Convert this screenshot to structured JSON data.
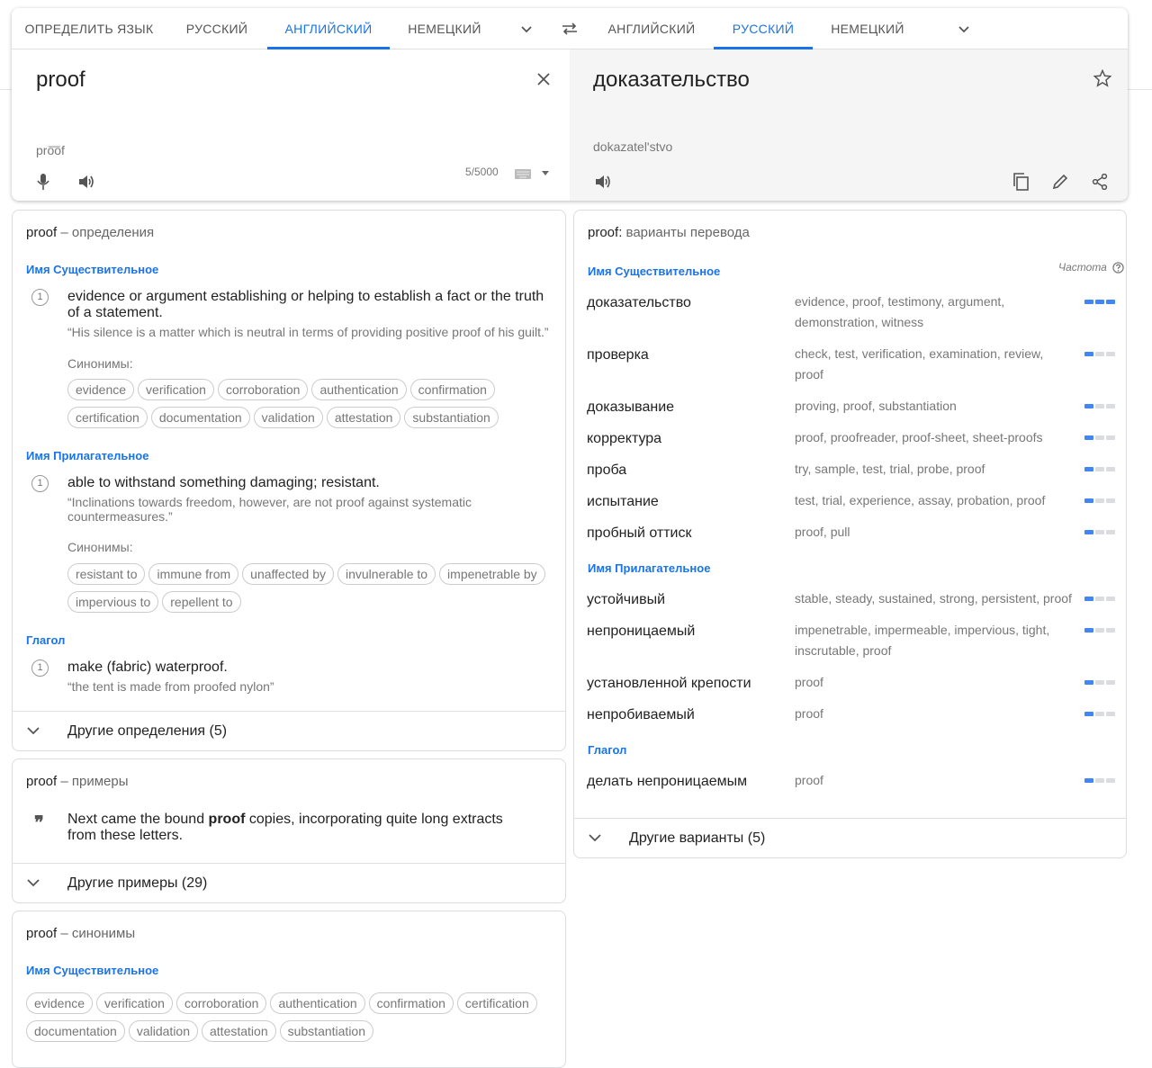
{
  "source_langs": [
    "ОПРЕДЕЛИТЬ ЯЗЫК",
    "РУССКИЙ",
    "АНГЛИЙСКИЙ",
    "НЕМЕЦКИЙ"
  ],
  "target_langs": [
    "АНГЛИЙСКИЙ",
    "РУССКИЙ",
    "НЕМЕЦКИЙ"
  ],
  "source_active": "АНГЛИЙСКИЙ",
  "target_active": "РУССКИЙ",
  "source": {
    "text": "proof",
    "translit": "pro͞of",
    "counter": "5/5000"
  },
  "target": {
    "text": "доказательство",
    "translit": "dokazatel'stvo"
  },
  "definitions": {
    "word": "proof",
    "title_suffix": "– определения",
    "noun": {
      "pos": "Имя Существительное",
      "num": "1",
      "def": "evidence or argument establishing or helping to establish a fact or the truth of a statement.",
      "example": "“His silence is a matter which is neutral in terms of providing positive proof of his guilt.”",
      "syn_label": "Синонимы:",
      "synonyms": [
        "evidence",
        "verification",
        "corroboration",
        "authentication",
        "confirmation",
        "certification",
        "documentation",
        "validation",
        "attestation",
        "substantiation"
      ]
    },
    "adj": {
      "pos": "Имя Прилагательное",
      "num": "1",
      "def": "able to withstand something damaging; resistant.",
      "example": "“Inclinations towards freedom, however, are not proof against systematic countermeasures.”",
      "syn_label": "Синонимы:",
      "synonyms": [
        "resistant to",
        "immune from",
        "unaffected by",
        "invulnerable to",
        "impenetrable by",
        "impervious to",
        "repellent to"
      ]
    },
    "verb": {
      "pos": "Глагол",
      "num": "1",
      "def": "make (fabric) waterproof.",
      "example": "“the tent is made from proofed nylon”"
    },
    "more": "Другие определения (5)"
  },
  "examples": {
    "word": "proof",
    "title_suffix": "– примеры",
    "quote_icon": "❞",
    "before": "Next came the bound ",
    "bold": "proof",
    "after": " copies, incorporating quite long extracts from these letters.",
    "more": "Другие примеры (29)"
  },
  "synonyms_card": {
    "word": "proof",
    "title_suffix": "– синонимы",
    "pos": "Имя Существительное",
    "items": [
      "evidence",
      "verification",
      "corroboration",
      "authentication",
      "confirmation",
      "certification",
      "documentation",
      "validation",
      "attestation",
      "substantiation"
    ]
  },
  "translations": {
    "word": "proof:",
    "title_suffix": "варианты перевода",
    "freq_label": "Частота",
    "groups": [
      {
        "pos": "Имя Существительное",
        "rows": [
          {
            "ru": "доказательство",
            "en": "evidence, proof, testimony, argument, demonstration, witness",
            "freq": 3
          },
          {
            "ru": "проверка",
            "en": "check, test, verification, examination, review, proof",
            "freq": 1
          },
          {
            "ru": "доказывание",
            "en": "proving, proof, substantiation",
            "freq": 1
          },
          {
            "ru": "корректура",
            "en": "proof, proofreader, proof-sheet, sheet-proofs",
            "freq": 1
          },
          {
            "ru": "проба",
            "en": "try, sample, test, trial, probe, proof",
            "freq": 1
          },
          {
            "ru": "испытание",
            "en": "test, trial, experience, assay, probation, proof",
            "freq": 1
          },
          {
            "ru": "пробный оттиск",
            "en": "proof, pull",
            "freq": 1
          }
        ]
      },
      {
        "pos": "Имя Прилагательное",
        "rows": [
          {
            "ru": "устойчивый",
            "en": "stable, steady, sustained, strong, persistent, proof",
            "freq": 1
          },
          {
            "ru": "непроницаемый",
            "en": "impenetrable, impermeable, impervious, tight, inscrutable, proof",
            "freq": 1
          },
          {
            "ru": "установленной крепости",
            "en": "proof",
            "freq": 1
          },
          {
            "ru": "непробиваемый",
            "en": "proof",
            "freq": 1
          }
        ]
      },
      {
        "pos": "Глагол",
        "rows": [
          {
            "ru": "делать непроницаемым",
            "en": "proof",
            "freq": 1
          }
        ]
      }
    ],
    "more": "Другие варианты (5)"
  }
}
